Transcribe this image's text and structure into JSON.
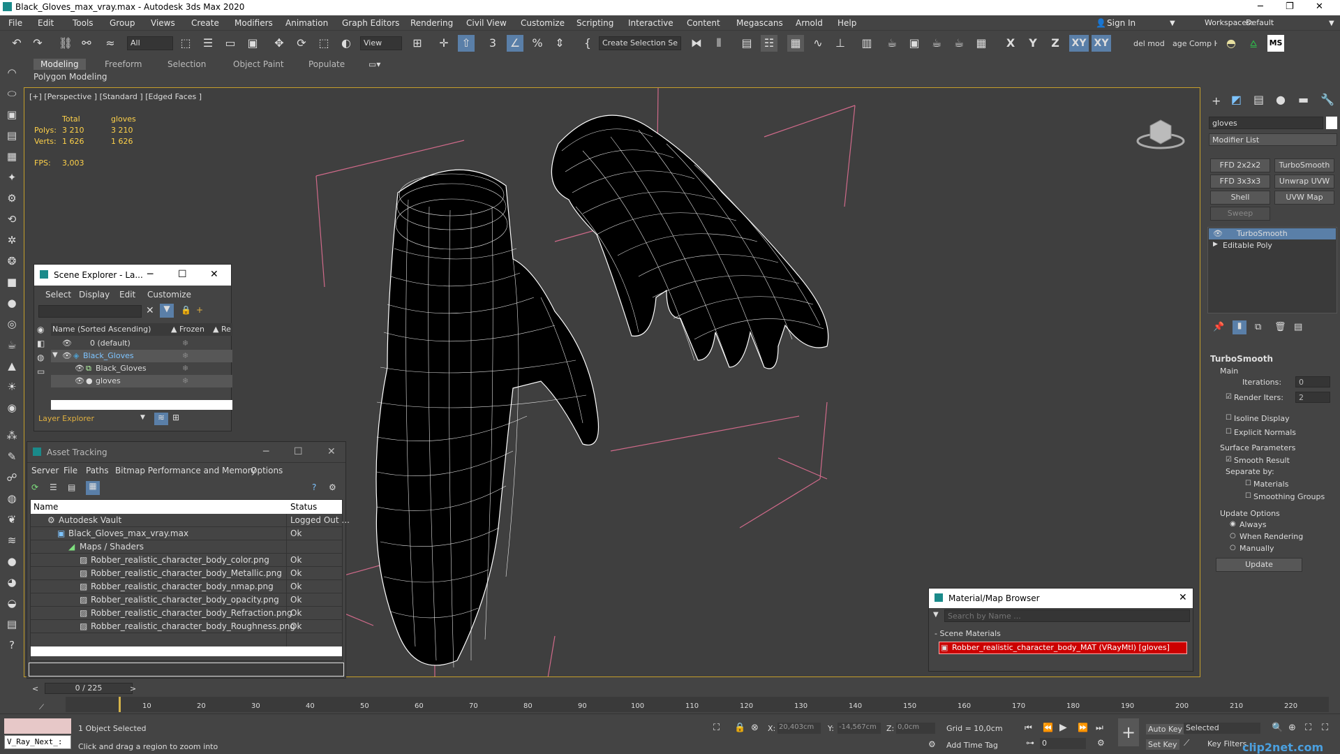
{
  "window": {
    "title": "Black_Gloves_max_vray.max - Autodesk 3ds Max 2020"
  },
  "menu": [
    "File",
    "Edit",
    "Tools",
    "Group",
    "Views",
    "Create",
    "Modifiers",
    "Animation",
    "Graph Editors",
    "Rendering",
    "Civil View",
    "Customize",
    "Scripting",
    "Interactive",
    "Content",
    "Megascans",
    "Arnold",
    "Help"
  ],
  "account": {
    "sign_in": "Sign In",
    "workspaces_label": "Workspaces:",
    "workspace": "Default"
  },
  "toolbar": {
    "filter": "All",
    "ref_coord": "View",
    "selection_set": "Create Selection Se",
    "axis_x": "X",
    "axis_y": "Y",
    "axis_z": "Z",
    "axis_xy": "XY",
    "axis_xy2": "XY",
    "del_mod": "del mod",
    "comp_help": "age Comp Help",
    "ms": "MS"
  },
  "ribbon": {
    "tabs": [
      "Modeling",
      "Freeform",
      "Selection",
      "Object Paint",
      "Populate"
    ],
    "sub": "Polygon Modeling"
  },
  "viewport": {
    "label": "[+] [Perspective ] [Standard ] [Edged Faces ]",
    "stats": {
      "total_header": "Total",
      "obj_header": "gloves",
      "polys_label": "Polys:",
      "polys_total": "3 210",
      "polys_obj": "3 210",
      "verts_label": "Verts:",
      "verts_total": "1 626",
      "verts_obj": "1 626",
      "fps_label": "FPS:",
      "fps": "3,003"
    }
  },
  "scene_explorer": {
    "title": "Scene Explorer - La...",
    "menu": [
      "Select",
      "Display",
      "Edit",
      "Customize"
    ],
    "col_name": "Name (Sorted Ascending)",
    "col_frozen": "▲ Frozen",
    "col_re": "▲ Re",
    "rows": [
      "0 (default)",
      "Black_Gloves",
      "Black_Gloves",
      "gloves"
    ],
    "layer_explorer": "Layer Explorer"
  },
  "asset_tracking": {
    "title": "Asset Tracking",
    "menu": [
      "Server",
      "File",
      "Paths",
      "Bitmap Performance and Memory",
      "Options"
    ],
    "col_name": "Name",
    "col_status": "Status",
    "rows": [
      {
        "name": "Autodesk Vault",
        "status": "Logged Out ..."
      },
      {
        "name": "Black_Gloves_max_vray.max",
        "status": "Ok"
      },
      {
        "name": "Maps / Shaders",
        "status": ""
      },
      {
        "name": "Robber_realistic_character_body_color.png",
        "status": "Ok"
      },
      {
        "name": "Robber_realistic_character_body_Metallic.png",
        "status": "Ok"
      },
      {
        "name": "Robber_realistic_character_body_nmap.png",
        "status": "Ok"
      },
      {
        "name": "Robber_realistic_character_body_opacity.png",
        "status": "Ok"
      },
      {
        "name": "Robber_realistic_character_body_Refraction.png",
        "status": "Ok"
      },
      {
        "name": "Robber_realistic_character_body_Roughness.png",
        "status": "Ok"
      }
    ]
  },
  "material_browser": {
    "title": "Material/Map Browser",
    "search_placeholder": "Search by Name ...",
    "section": "- Scene Materials",
    "material": "Robber_realistic_character_body_MAT (VRayMtl) [gloves]"
  },
  "command_panel": {
    "object_name": "gloves",
    "modifier_list": "Modifier List",
    "buttons": [
      "FFD 2x2x2",
      "TurboSmooth",
      "FFD 3x3x3",
      "Unwrap UVW",
      "Shell",
      "UVW Map",
      "Sweep"
    ],
    "stack": [
      "TurboSmooth",
      "Editable Poly"
    ],
    "rollout": "TurboSmooth",
    "main": "Main",
    "iterations_label": "Iterations:",
    "iterations": "0",
    "render_iters_label": "Render Iters:",
    "render_iters": "2",
    "isoline": "Isoline Display",
    "explicit_normals": "Explicit Normals",
    "surface_params": "Surface Parameters",
    "smooth_result": "Smooth Result",
    "separate_by": "Separate by:",
    "materials": "Materials",
    "smoothing_groups": "Smoothing Groups",
    "update_options": "Update Options",
    "always": "Always",
    "when_rendering": "When Rendering",
    "manually": "Manually",
    "update": "Update"
  },
  "timeline": {
    "frame": "0 / 225",
    "ticks": [
      "0",
      "10",
      "20",
      "30",
      "40",
      "50",
      "60",
      "70",
      "80",
      "90",
      "100",
      "110",
      "120",
      "130",
      "140",
      "150",
      "160",
      "170",
      "180",
      "190",
      "200",
      "210",
      "220"
    ]
  },
  "status": {
    "script_field": "V_Ray_Next_:",
    "selected": "1 Object Selected",
    "hint": "Click and drag a region to zoom into",
    "x_label": "X:",
    "x": "20,403cm",
    "y_label": "Y:",
    "y": "-14,567cm",
    "z_label": "Z:",
    "z": "0,0cm",
    "grid": "Grid = 10,0cm",
    "add_time_tag": "Add Time Tag",
    "auto_key": "Auto Key",
    "set_key": "Set Key",
    "selected_dd": "Selected",
    "key_filters": "Key Filters...",
    "frame_field": "0",
    "watermark": "clip2net.com"
  }
}
